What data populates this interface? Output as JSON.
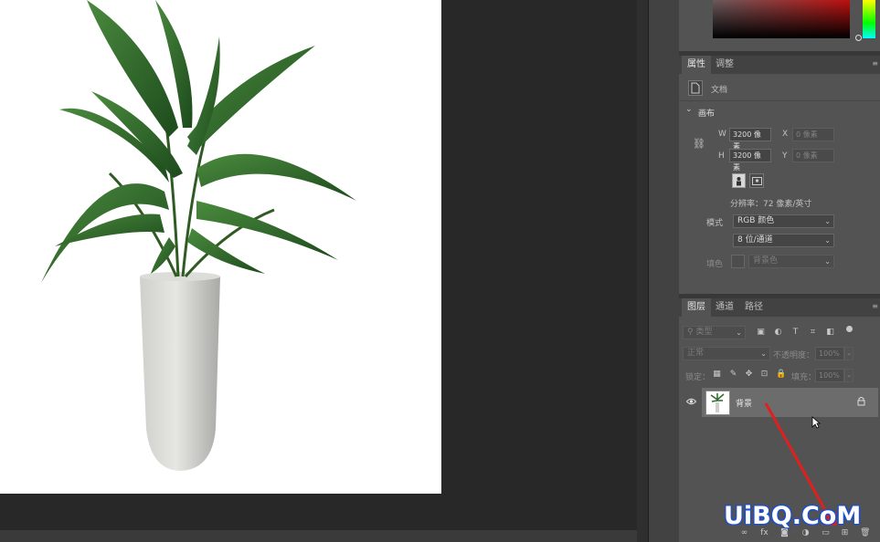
{
  "properties_panel": {
    "tabs": [
      {
        "label": "属性",
        "active": true
      },
      {
        "label": "调整",
        "active": false
      }
    ],
    "doc_type": "文档",
    "canvas_section": "画布",
    "width_label": "W",
    "width_value": "3200 像素",
    "height_label": "H",
    "height_value": "3200 像素",
    "x_label": "X",
    "x_placeholder": "0 像素",
    "y_label": "Y",
    "y_placeholder": "0 像素",
    "resolution": "分辨率：72 像素/英寸",
    "mode_label": "模式",
    "mode_value": "RGB 颜色",
    "bit_depth": "8 位/通道",
    "fill_label": "填色",
    "fill_value": "背景色"
  },
  "layers_panel": {
    "tabs": [
      {
        "label": "图层",
        "active": true
      },
      {
        "label": "通道",
        "active": false
      },
      {
        "label": "路径",
        "active": false
      }
    ],
    "filter_kind": "类型",
    "blend_mode": "正常",
    "opacity_label": "不透明度：",
    "opacity_value": "100%",
    "lock_label": "锁定：",
    "fill_label": "填充：",
    "fill_value": "100%",
    "layers": [
      {
        "name": "背景",
        "visible": true,
        "locked": true
      }
    ]
  },
  "watermark": "UiBQ.CoM",
  "colors": {
    "accent_arrow": "#e0201e",
    "watermark_outline": "#1a4fd8"
  }
}
